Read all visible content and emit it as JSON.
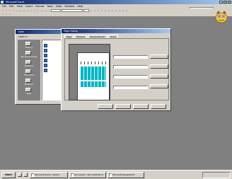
{
  "app": {
    "title": "Microsoft Excel",
    "menus": [
      "File",
      "Edit",
      "View",
      "Insert",
      "Format",
      "Tools",
      "Data",
      "Window",
      "Help"
    ],
    "help_placeholder": "Type a question",
    "cap_min": "_",
    "cap_max": "□",
    "cap_close": "×"
  },
  "open_dialog": {
    "title": "Open",
    "look_in": "Look in:",
    "places": [
      "History",
      "My Documents",
      "Desktop",
      "Favorites",
      "Network",
      "Web"
    ],
    "files": [
      "",
      "",
      "",
      "",
      "",
      ""
    ]
  },
  "page_setup": {
    "title": "Page Setup",
    "tabs": [
      "Page",
      "Margins",
      "Header/Footer",
      "Sheet"
    ],
    "fields": [
      "",
      "",
      "",
      ""
    ],
    "side_buttons": [
      "",
      "",
      "",
      ""
    ],
    "buttons": [
      "",
      "",
      "",
      ""
    ]
  },
  "taskbar": {
    "start": "start",
    "tasks": [
      "Microsoft Excel - Book1",
      "Document - Microsoft Word",
      "Microsoft PowerPoint"
    ],
    "clock": ""
  },
  "colors": {
    "title_active": "#0a246a",
    "title_gradient_end": "#a6caf0",
    "preview_cells": "#00b7c3",
    "desktop": "#808080"
  }
}
